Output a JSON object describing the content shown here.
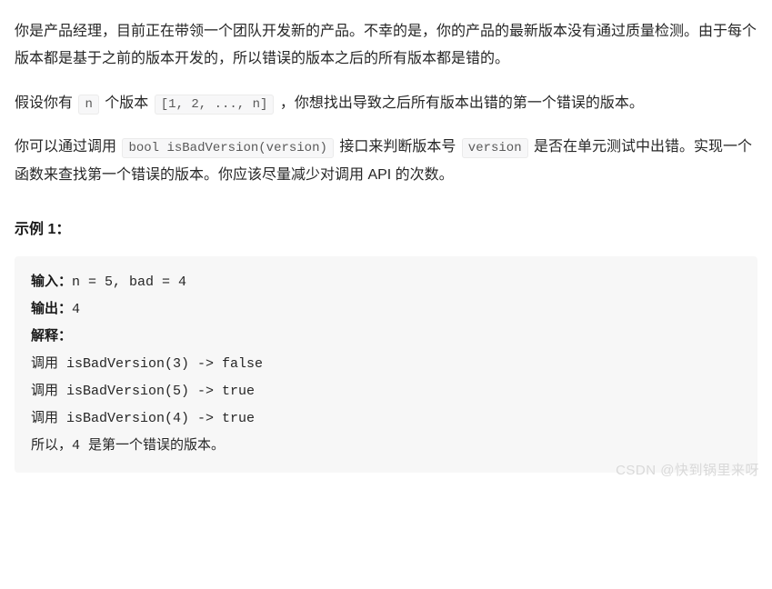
{
  "para1": {
    "text": "你是产品经理，目前正在带领一个团队开发新的产品。不幸的是，你的产品的最新版本没有通过质量检测。由于每个版本都是基于之前的版本开发的，所以错误的版本之后的所有版本都是错的。"
  },
  "para2": {
    "prefix": "假设你有 ",
    "code_n": "n",
    "between": " 个版本 ",
    "code_arr": "[1, 2, ..., n]",
    "suffix": " ，你想找出导致之后所有版本出错的第一个错误的版本。"
  },
  "para3": {
    "prefix": "你可以通过调用 ",
    "code_func": "bool isBadVersion(version)",
    "mid1": " 接口来判断版本号 ",
    "code_ver": "version",
    "suffix": " 是否在单元测试中出错。实现一个函数来查找第一个错误的版本。你应该尽量减少对调用 API 的次数。"
  },
  "example": {
    "heading": "示例 1：",
    "input_label": "输入：",
    "input_value": "n = 5, bad = 4",
    "output_label": "输出：",
    "output_value": "4",
    "explain_label": "解释：",
    "line1": "调用 isBadVersion(3) -> false",
    "line2": "调用 isBadVersion(5) -> true",
    "line3": "调用 isBadVersion(4) -> true",
    "line4": "所以，4 是第一个错误的版本。"
  },
  "watermark": "CSDN @快到锅里来呀"
}
